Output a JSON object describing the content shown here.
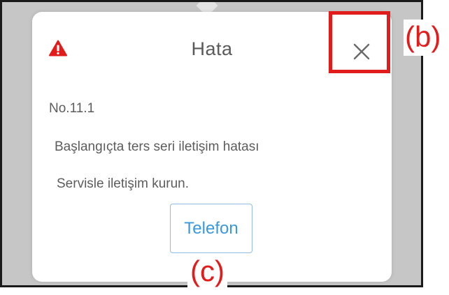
{
  "dialog": {
    "title": "Hata",
    "icon": "warning-icon",
    "close_icon": "close-icon",
    "error_code": "No.11.1",
    "message_line1": "Başlangıçta ters seri iletişim hatası",
    "message_line2": "Servisle iletişim kurun.",
    "phone_button_label": "Telefon"
  },
  "annotations": {
    "close_label": "(b)",
    "phone_label": "(c)"
  },
  "colors": {
    "accent": "#3a98dc",
    "warning": "#e21b1b",
    "annotation": "#e21b1b",
    "backdrop": "#c6c6c6"
  }
}
